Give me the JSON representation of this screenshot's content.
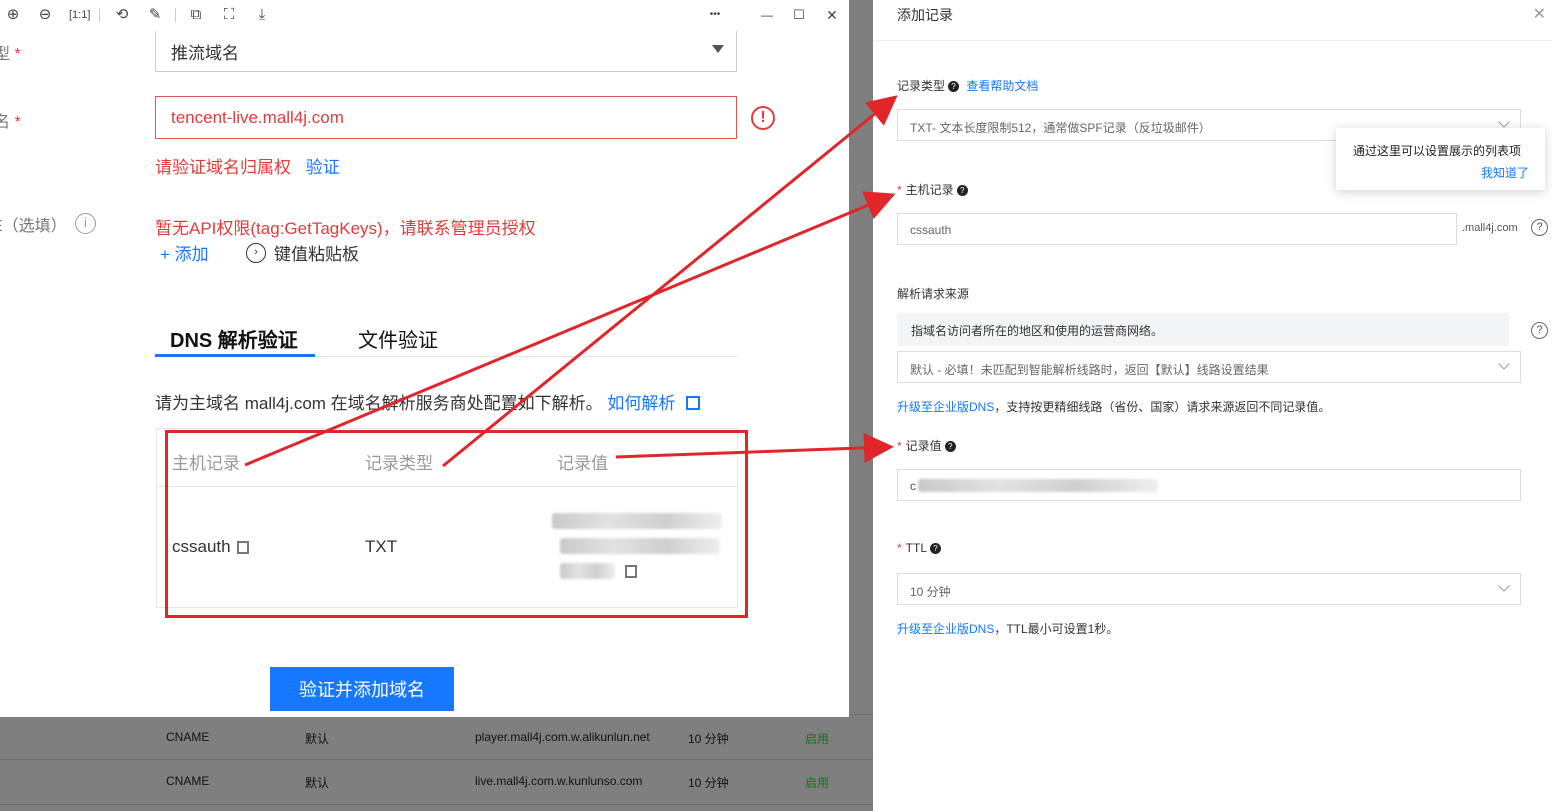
{
  "viewer": {
    "toolbar_icons": [
      "zoom-in-icon",
      "zoom-out-icon",
      "fit-icon",
      "rotate-icon",
      "edit-icon",
      "crop-icon",
      "fullscreen-icon",
      "download-icon",
      "more-icon",
      "minimize-icon",
      "maximize-icon",
      "close-icon"
    ],
    "more_glyph": "•••",
    "minimize_glyph": "—",
    "maximize_glyph": "☐",
    "close_glyph": "✕"
  },
  "form": {
    "label1_cut": "型",
    "label2_cut": "名",
    "label3_cut": "E（选填）",
    "required_mark": "*",
    "domain_type_value": "推流域名",
    "domain_value": "tencent-live.mall4j.com",
    "error_glyph": "!",
    "verify_error": "请验证域名归属权",
    "verify_link": "验证",
    "tag_error": "暂无API权限(tag:GetTagKeys)，请联系管理员授权",
    "add_label": "+ 添加",
    "paste_label": "键值粘贴板",
    "tabs": [
      "DNS 解析验证",
      "文件验证"
    ],
    "instruction": "请为主域名 mall4j.com 在域名解析服务商处配置如下解析。",
    "how_link": "如何解析",
    "table_headers": [
      "主机记录",
      "记录类型",
      "记录值"
    ],
    "host": "cssauth",
    "type": "TXT",
    "submit": "验证并添加域名"
  },
  "bg_rows": [
    {
      "type": "CNAME",
      "line": "默认",
      "value": "player.mall4j.com.w.alikunlun.net",
      "ttl": "10 分钟",
      "status": "启用"
    },
    {
      "type": "CNAME",
      "line": "默认",
      "value": "live.mall4j.com.w.kunlunso.com",
      "ttl": "10 分钟",
      "status": "启用"
    }
  ],
  "drawer": {
    "title": "添加记录",
    "close": "✕",
    "record_type_label": "记录类型",
    "help_link": "查看帮助文档",
    "record_type_value": "TXT- 文本长度限制512，通常做SPF记录（反垃圾邮件）",
    "host_label": "主机记录",
    "host_value": "cssauth",
    "domain_suffix": ".mall4j.com",
    "source_label": "解析请求来源",
    "source_note": "指域名访问者所在的地区和使用的运营商网络。",
    "source_value": "默认 - 必填！未匹配到智能解析线路时，返回【默认】线路设置结果",
    "upgrade_link": "升级至企业版DNS",
    "upgrade_text1": "，支持按更精细线路（省份、国家）请求来源返回不同记录值。",
    "value_label": "记录值",
    "value_prefix": "c",
    "ttl_label": "TTL",
    "ttl_value": "10 分钟",
    "upgrade_text2": "，TTL最小可设置1秒。",
    "tooltip_text": "通过这里可以设置展示的列表项",
    "tooltip_ack": "我知道了",
    "question_glyph": "?"
  }
}
